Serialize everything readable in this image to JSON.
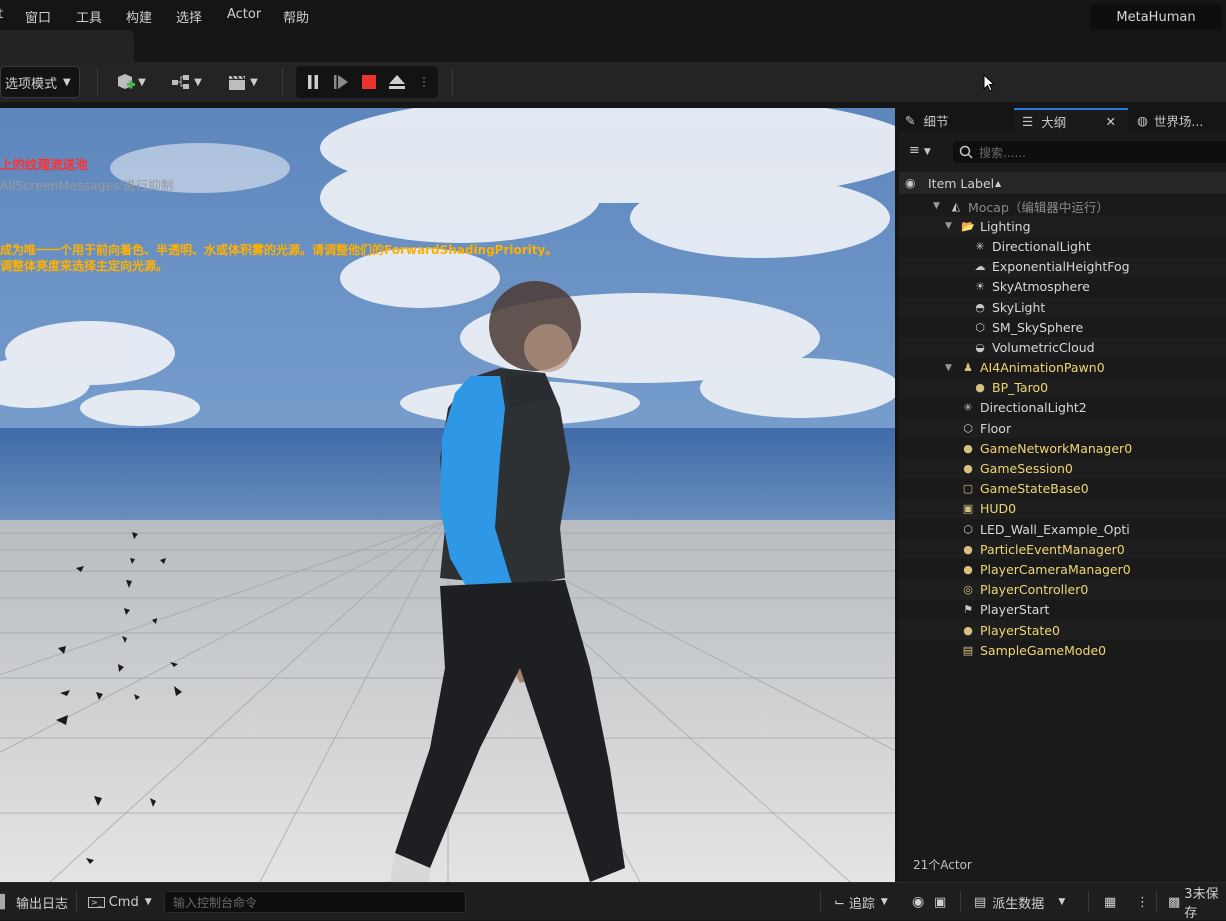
{
  "menubar": {
    "items": [
      "窗口",
      "工具",
      "构建",
      "选择",
      "Actor",
      "帮助"
    ],
    "project_name": "MetaHuman"
  },
  "toolbar": {
    "mode_label": "选项模式"
  },
  "viewport": {
    "messages": [
      {
        "text": "上的纹理流送池",
        "color": "#ff3030"
      },
      {
        "text": "AllScreenMessages'进行抑制",
        "color": "#9a9a9a"
      },
      {
        "text": "成为唯一一个用于前向着色、半透明、水或体积雾的光源。请调整他们的ForwardShadingPriority。",
        "color": "#ffb000"
      },
      {
        "text": "调整体亮度来选择主定向光源。",
        "color": "#ffb000"
      }
    ]
  },
  "panel": {
    "tabs": [
      {
        "label": "细节",
        "icon": "pencil-icon"
      },
      {
        "label": "大纲",
        "icon": "list-icon",
        "active": true
      },
      {
        "label": "世界场...",
        "icon": "globe-icon"
      }
    ],
    "search_placeholder": "搜索......",
    "column_header": "Item Label",
    "actor_count": "21个Actor"
  },
  "outliner": [
    {
      "label": "Mocap（编辑器中运行）",
      "indent": 0,
      "arrow": true,
      "color": "grey",
      "icon": "level-icon"
    },
    {
      "label": "Lighting",
      "indent": 1,
      "arrow": true,
      "color": "white",
      "icon": "folder-icon"
    },
    {
      "label": "DirectionalLight",
      "indent": 2,
      "color": "white",
      "icon": "sun-icon"
    },
    {
      "label": "ExponentialHeightFog",
      "indent": 2,
      "color": "white",
      "icon": "fog-icon"
    },
    {
      "label": "SkyAtmosphere",
      "indent": 2,
      "color": "white",
      "icon": "atmosphere-icon"
    },
    {
      "label": "SkyLight",
      "indent": 2,
      "color": "white",
      "icon": "skylight-icon"
    },
    {
      "label": "SM_SkySphere",
      "indent": 2,
      "color": "white",
      "icon": "cube-icon"
    },
    {
      "label": "VolumetricCloud",
      "indent": 2,
      "color": "white",
      "icon": "cloud-icon"
    },
    {
      "label": "AI4AnimationPawn0",
      "indent": 1,
      "arrow": true,
      "color": "yellow",
      "icon": "pawn-icon"
    },
    {
      "label": "BP_Taro0",
      "indent": 2,
      "color": "yellow",
      "icon": "actor-icon"
    },
    {
      "label": "DirectionalLight2",
      "indent": 1,
      "color": "white",
      "icon": "sun-icon"
    },
    {
      "label": "Floor",
      "indent": 1,
      "color": "white",
      "icon": "cube-icon"
    },
    {
      "label": "GameNetworkManager0",
      "indent": 1,
      "color": "yellow",
      "icon": "actor-icon"
    },
    {
      "label": "GameSession0",
      "indent": 1,
      "color": "yellow",
      "icon": "actor-icon"
    },
    {
      "label": "GameStateBase0",
      "indent": 1,
      "color": "yellow",
      "icon": "gamestate-icon"
    },
    {
      "label": "HUD0",
      "indent": 1,
      "color": "yellow",
      "icon": "hud-icon"
    },
    {
      "label": "LED_Wall_Example_Opti",
      "indent": 1,
      "color": "white",
      "icon": "cube-icon"
    },
    {
      "label": "ParticleEventManager0",
      "indent": 1,
      "color": "yellow",
      "icon": "actor-icon"
    },
    {
      "label": "PlayerCameraManager0",
      "indent": 1,
      "color": "yellow",
      "icon": "actor-icon"
    },
    {
      "label": "PlayerController0",
      "indent": 1,
      "color": "yellow",
      "icon": "gamepad-icon"
    },
    {
      "label": "PlayerStart",
      "indent": 1,
      "color": "white",
      "icon": "flag-icon"
    },
    {
      "label": "PlayerState0",
      "indent": 1,
      "color": "yellow",
      "icon": "actor-icon"
    },
    {
      "label": "SampleGameMode0",
      "indent": 1,
      "color": "yellow",
      "icon": "gamemode-icon"
    }
  ],
  "statusbar": {
    "output_log": "输出日志",
    "cmd_label": "Cmd",
    "console_placeholder": "输入控制台命令",
    "trace_label": "追踪",
    "derived_data_label": "派生数据",
    "unsaved_label": "3未保存"
  }
}
